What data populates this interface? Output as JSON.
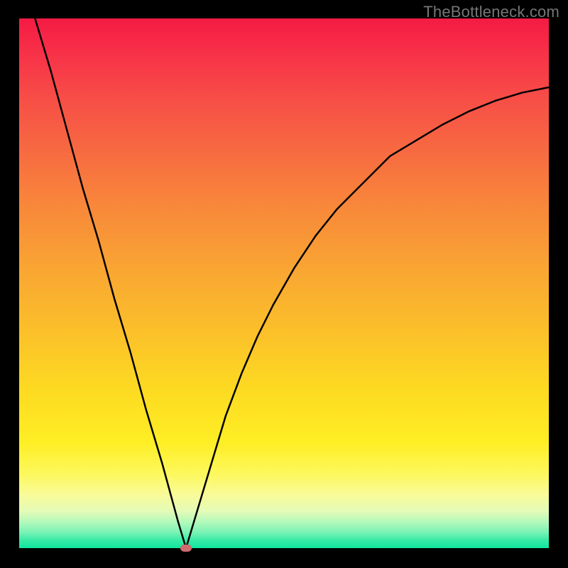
{
  "watermark": "TheBottleneck.com",
  "colors": {
    "frame": "#000000",
    "curve": "#000000",
    "marker": "#cf6a6d",
    "gradient_top": "#f41b43",
    "gradient_bottom": "#0fe79e"
  },
  "chart_data": {
    "type": "line",
    "title": "",
    "xlabel": "",
    "ylabel": "",
    "xlim": [
      0,
      100
    ],
    "ylim": [
      0,
      100
    ],
    "grid": false,
    "annotations": [
      "TheBottleneck.com"
    ],
    "marker": {
      "x": 31.5,
      "y": 0
    },
    "series": [
      {
        "name": "curve",
        "x": [
          3,
          6,
          9,
          12,
          15,
          18,
          21,
          24,
          27,
          30,
          31.5,
          33,
          36,
          39,
          42,
          45,
          48,
          52,
          56,
          60,
          65,
          70,
          75,
          80,
          85,
          90,
          95,
          100
        ],
        "y": [
          100,
          90,
          79,
          68,
          58,
          47,
          37,
          26,
          16,
          5,
          0,
          5,
          15,
          25,
          33,
          40,
          46,
          53,
          59,
          64,
          69,
          74,
          77,
          80,
          82.5,
          84.5,
          86,
          87
        ]
      }
    ]
  }
}
